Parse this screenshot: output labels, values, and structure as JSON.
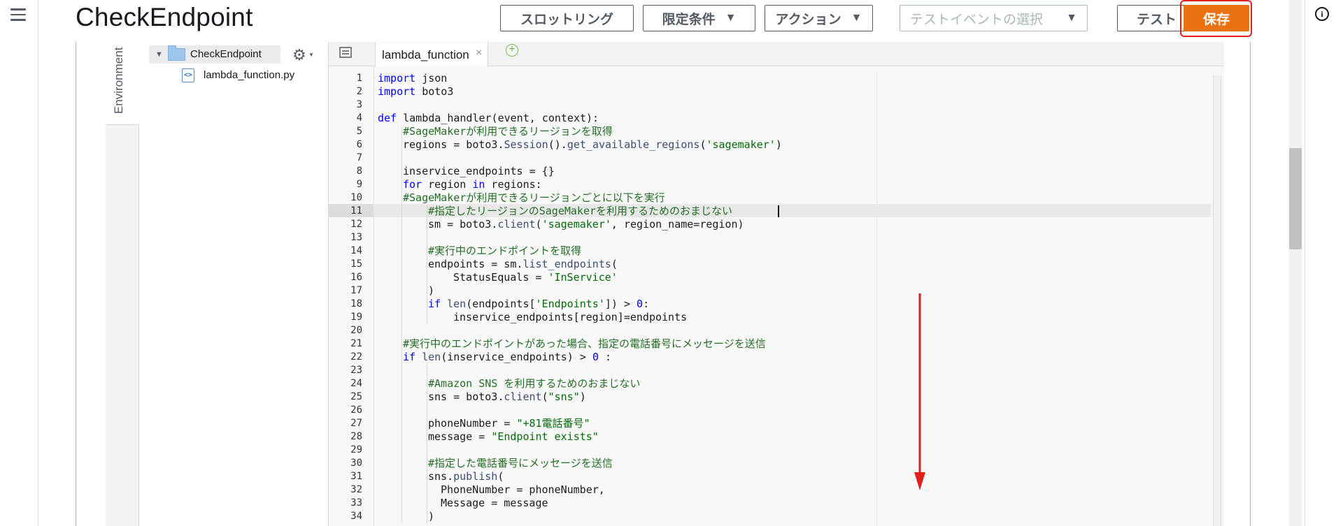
{
  "header": {
    "title": "CheckEndpoint",
    "buttons": {
      "throttle": "スロットリング",
      "qualifiers": "限定条件",
      "actions": "アクション",
      "test_event_placeholder": "テストイベントの選択",
      "test": "テスト",
      "save": "保存"
    }
  },
  "environment": {
    "tab_label": "Environment",
    "folder_name": "CheckEndpoint",
    "file_name": "lambda_function.py"
  },
  "editor": {
    "tab_label": "lambda_function",
    "cursor_line": 11,
    "lines": [
      {
        "n": "1",
        "indent": 0,
        "text": "import json"
      },
      {
        "n": "2",
        "indent": 0,
        "text": "import boto3"
      },
      {
        "n": "3",
        "indent": 0,
        "text": ""
      },
      {
        "n": "4",
        "indent": 0,
        "text": "def lambda_handler(event, context):"
      },
      {
        "n": "5",
        "indent": 4,
        "text": "#SageMakerが利用できるリージョンを取得"
      },
      {
        "n": "6",
        "indent": 4,
        "text": "regions = boto3.Session().get_available_regions('sagemaker')"
      },
      {
        "n": "7",
        "indent": 0,
        "text": ""
      },
      {
        "n": "8",
        "indent": 4,
        "text": "inservice_endpoints = {}"
      },
      {
        "n": "9",
        "indent": 4,
        "text": "for region in regions:"
      },
      {
        "n": "10",
        "indent": 4,
        "text": "#SageMakerが利用できるリージョンごとに以下を実行"
      },
      {
        "n": "11",
        "indent": 8,
        "text": "#指定したリージョンのSageMakerを利用するためのおまじない"
      },
      {
        "n": "12",
        "indent": 8,
        "text": "sm = boto3.client('sagemaker', region_name=region)"
      },
      {
        "n": "13",
        "indent": 0,
        "text": ""
      },
      {
        "n": "14",
        "indent": 8,
        "text": "#実行中のエンドポイントを取得"
      },
      {
        "n": "15",
        "indent": 8,
        "text": "endpoints = sm.list_endpoints("
      },
      {
        "n": "16",
        "indent": 12,
        "text": "StatusEquals = 'InService'"
      },
      {
        "n": "17",
        "indent": 8,
        "text": ")"
      },
      {
        "n": "18",
        "indent": 8,
        "text": "if len(endpoints['Endpoints']) > 0:"
      },
      {
        "n": "19",
        "indent": 12,
        "text": "inservice_endpoints[region]=endpoints"
      },
      {
        "n": "20",
        "indent": 0,
        "text": ""
      },
      {
        "n": "21",
        "indent": 4,
        "text": "#実行中のエンドポイントがあった場合、指定の電話番号にメッセージを送信"
      },
      {
        "n": "22",
        "indent": 4,
        "text": "if len(inservice_endpoints) > 0 :"
      },
      {
        "n": "23",
        "indent": 0,
        "text": ""
      },
      {
        "n": "24",
        "indent": 8,
        "text": "#Amazon SNS を利用するためのおまじない"
      },
      {
        "n": "25",
        "indent": 8,
        "text": "sns = boto3.client(\"sns\")"
      },
      {
        "n": "26",
        "indent": 0,
        "text": ""
      },
      {
        "n": "27",
        "indent": 8,
        "text": "phoneNumber = \"+81電話番号\""
      },
      {
        "n": "28",
        "indent": 8,
        "text": "message = \"Endpoint exists\""
      },
      {
        "n": "29",
        "indent": 0,
        "text": ""
      },
      {
        "n": "30",
        "indent": 8,
        "text": "#指定した電話番号にメッセージを送信"
      },
      {
        "n": "31",
        "indent": 8,
        "text": "sns.publish("
      },
      {
        "n": "32",
        "indent": 10,
        "text": "PhoneNumber = phoneNumber,"
      },
      {
        "n": "33",
        "indent": 10,
        "text": "Message = message"
      },
      {
        "n": "34",
        "indent": 8,
        "text": ")"
      }
    ]
  },
  "colors": {
    "save_button": "#ec7211",
    "save_outline": "#e0201e",
    "annotation_arrow": "#e0201e",
    "keyword": "#0000ff",
    "comment": "#236e24",
    "string": "#036a07",
    "number": "#0000cd"
  },
  "icons": {
    "menu": "hamburger-icon",
    "info": "info-icon",
    "folder": "folder-icon",
    "file": "python-file-icon",
    "gear": "gear-icon",
    "tab_list": "tab-list-icon",
    "tab_add": "plus-circle-icon",
    "tab_close": "close-icon"
  }
}
